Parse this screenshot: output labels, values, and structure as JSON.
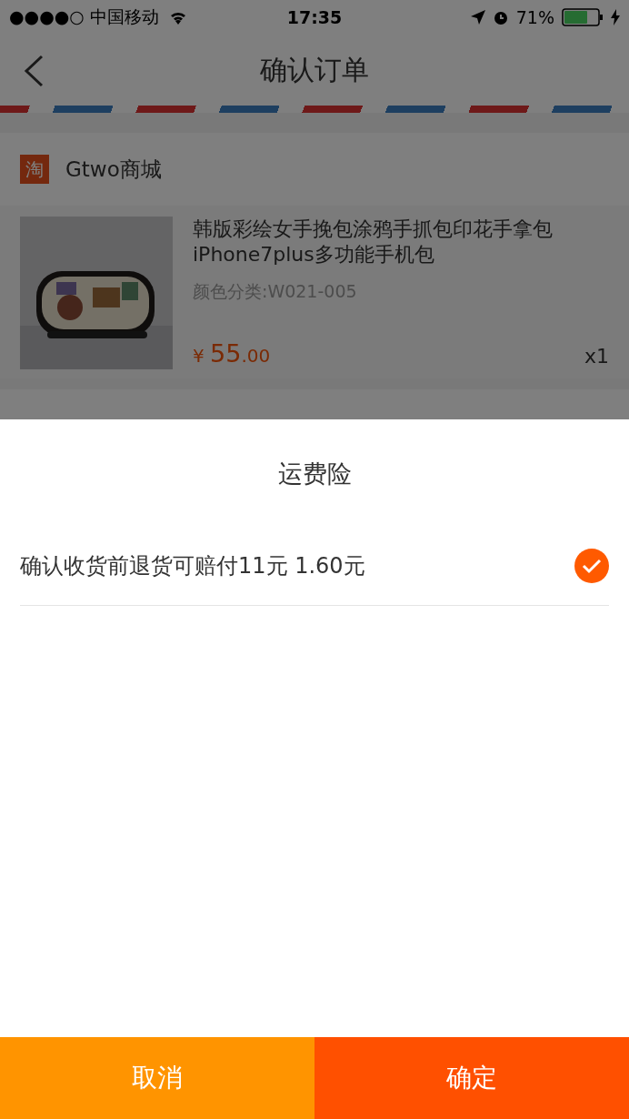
{
  "status_bar": {
    "carrier": "●●●●○ 中国移动",
    "time": "17:35",
    "battery_text": "71%"
  },
  "nav": {
    "title": "确认订单"
  },
  "shop": {
    "badge": "淘",
    "name": "Gtwo商城"
  },
  "product": {
    "kind": "picture",
    "title": "韩版彩绘女手挽包涂鸦手抓包印花手拿包iPhone7plus多功能手机包",
    "variant": "颜色分类:W021-005",
    "currency": "¥",
    "price_integer": "55",
    "price_decimal": ".00",
    "quantity": "x1"
  },
  "sheet": {
    "title": "运费险",
    "options": [
      {
        "label": "确认收货前退货可赔付11元 1.60元",
        "checked": true
      }
    ]
  },
  "buttons": [
    {
      "label": "取消",
      "kind": "cancel"
    },
    {
      "label": "确定",
      "kind": "confirm"
    }
  ]
}
